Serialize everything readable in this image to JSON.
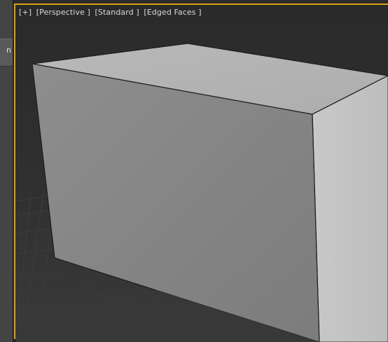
{
  "side_panel": {
    "tab_label": "n"
  },
  "viewport": {
    "labels": [
      "[+]",
      "[Perspective ]",
      "[Standard ]",
      "[Edged Faces ]"
    ],
    "active_border_color": "#d8a21a"
  },
  "scene": {
    "object": "box",
    "shading": "Edged Faces"
  }
}
